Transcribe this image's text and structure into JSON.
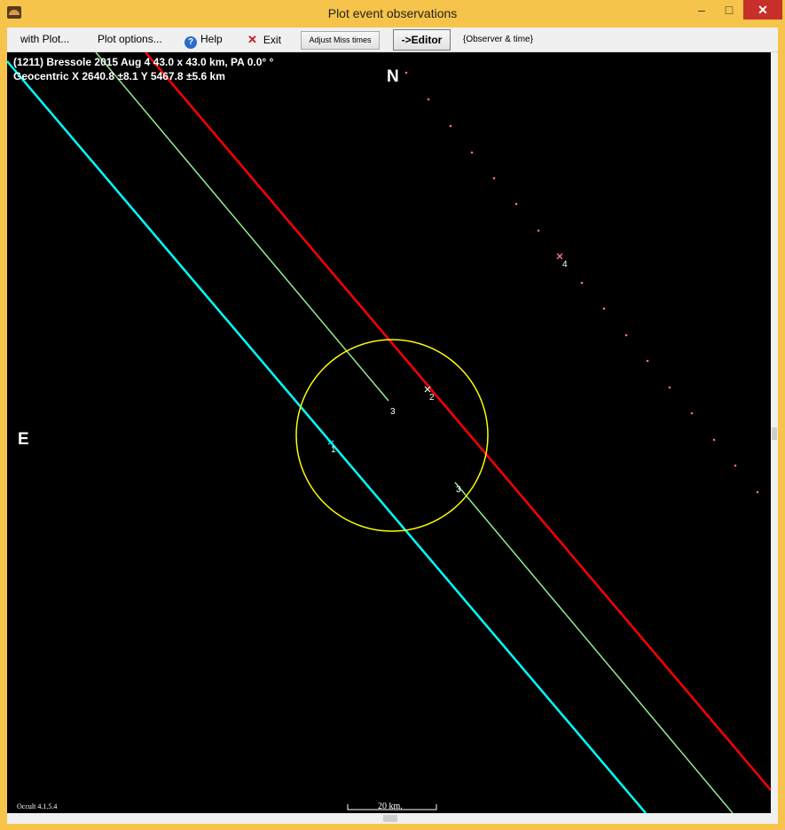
{
  "window": {
    "title": "Plot event observations",
    "controls": {
      "minimize": "–",
      "maximize": "□",
      "close": "✕"
    }
  },
  "menu": {
    "with_plot": "with Plot...",
    "plot_options": "Plot options...",
    "help": "Help",
    "exit": "Exit",
    "adjust_miss_times": "Adjust Miss times",
    "editor": "->Editor",
    "observer_time": "{Observer & time}"
  },
  "plot": {
    "info_line1": "(1211) Bressole  2015 Aug 4   43.0 x 43.0 km,  PA 0.0° °",
    "info_line2": "Geocentric  X  2640.8 ±8.1  Y 5467.8 ±5.6 km",
    "north": "N",
    "east": "E",
    "scale_label": "20 km.",
    "version": "Occult 4.1.5.4",
    "colors": {
      "background": "#000000",
      "ellipse": "#ffff00",
      "chord_1": "#00ffff",
      "chord_2": "#ff0000",
      "chord_3": "#90ee90",
      "chord_4": "#ff6f8f"
    },
    "chords": [
      {
        "label": "1",
        "color": "#00ffff"
      },
      {
        "label": "2",
        "color": "#ff0000"
      },
      {
        "label": "3",
        "color": "#90ee90"
      },
      {
        "label": "3",
        "color": "#90ee90"
      },
      {
        "label": "4",
        "color": "#ff6f8f"
      }
    ]
  }
}
